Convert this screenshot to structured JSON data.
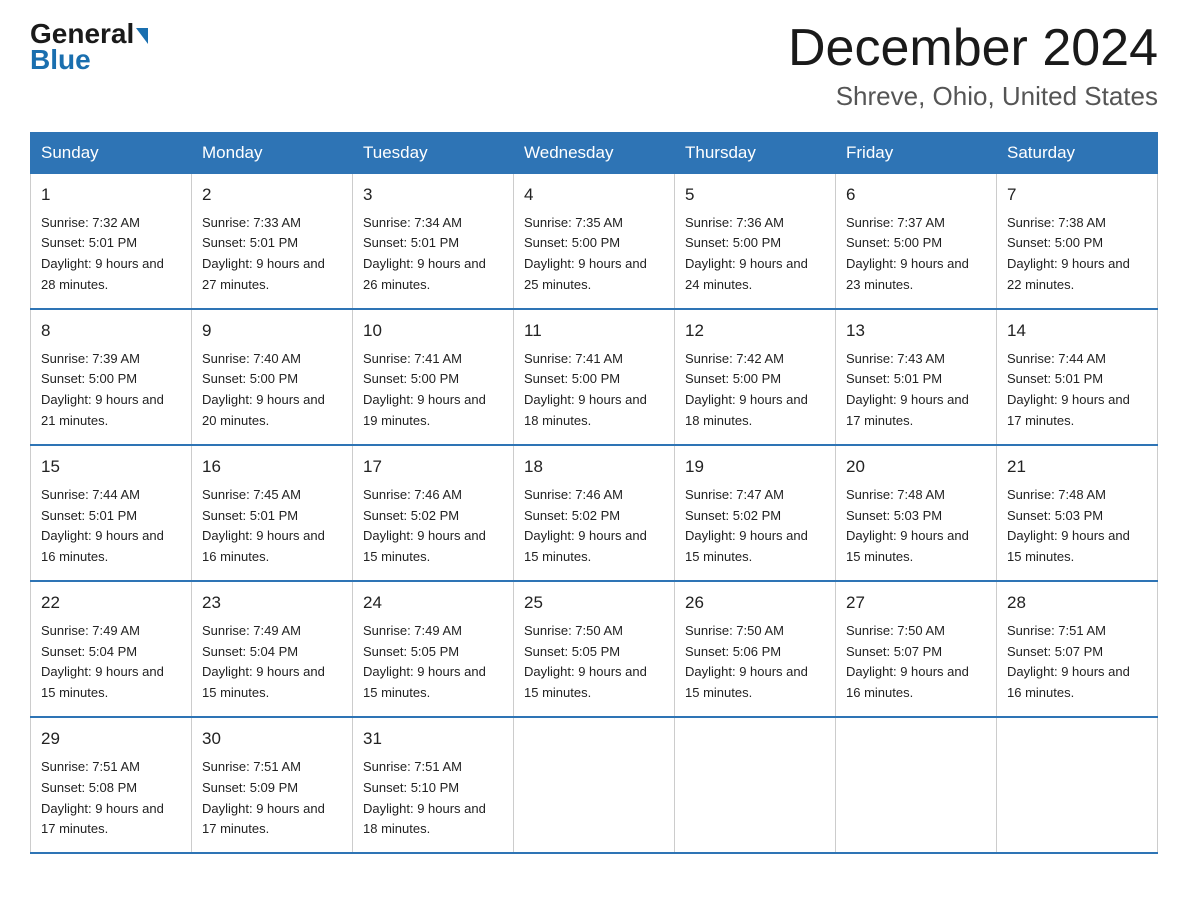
{
  "header": {
    "logo_general": "General",
    "logo_blue": "Blue",
    "month_title": "December 2024",
    "location": "Shreve, Ohio, United States"
  },
  "days_of_week": [
    "Sunday",
    "Monday",
    "Tuesday",
    "Wednesday",
    "Thursday",
    "Friday",
    "Saturday"
  ],
  "weeks": [
    [
      {
        "num": "1",
        "sunrise": "7:32 AM",
        "sunset": "5:01 PM",
        "daylight": "9 hours and 28 minutes."
      },
      {
        "num": "2",
        "sunrise": "7:33 AM",
        "sunset": "5:01 PM",
        "daylight": "9 hours and 27 minutes."
      },
      {
        "num": "3",
        "sunrise": "7:34 AM",
        "sunset": "5:01 PM",
        "daylight": "9 hours and 26 minutes."
      },
      {
        "num": "4",
        "sunrise": "7:35 AM",
        "sunset": "5:00 PM",
        "daylight": "9 hours and 25 minutes."
      },
      {
        "num": "5",
        "sunrise": "7:36 AM",
        "sunset": "5:00 PM",
        "daylight": "9 hours and 24 minutes."
      },
      {
        "num": "6",
        "sunrise": "7:37 AM",
        "sunset": "5:00 PM",
        "daylight": "9 hours and 23 minutes."
      },
      {
        "num": "7",
        "sunrise": "7:38 AM",
        "sunset": "5:00 PM",
        "daylight": "9 hours and 22 minutes."
      }
    ],
    [
      {
        "num": "8",
        "sunrise": "7:39 AM",
        "sunset": "5:00 PM",
        "daylight": "9 hours and 21 minutes."
      },
      {
        "num": "9",
        "sunrise": "7:40 AM",
        "sunset": "5:00 PM",
        "daylight": "9 hours and 20 minutes."
      },
      {
        "num": "10",
        "sunrise": "7:41 AM",
        "sunset": "5:00 PM",
        "daylight": "9 hours and 19 minutes."
      },
      {
        "num": "11",
        "sunrise": "7:41 AM",
        "sunset": "5:00 PM",
        "daylight": "9 hours and 18 minutes."
      },
      {
        "num": "12",
        "sunrise": "7:42 AM",
        "sunset": "5:00 PM",
        "daylight": "9 hours and 18 minutes."
      },
      {
        "num": "13",
        "sunrise": "7:43 AM",
        "sunset": "5:01 PM",
        "daylight": "9 hours and 17 minutes."
      },
      {
        "num": "14",
        "sunrise": "7:44 AM",
        "sunset": "5:01 PM",
        "daylight": "9 hours and 17 minutes."
      }
    ],
    [
      {
        "num": "15",
        "sunrise": "7:44 AM",
        "sunset": "5:01 PM",
        "daylight": "9 hours and 16 minutes."
      },
      {
        "num": "16",
        "sunrise": "7:45 AM",
        "sunset": "5:01 PM",
        "daylight": "9 hours and 16 minutes."
      },
      {
        "num": "17",
        "sunrise": "7:46 AM",
        "sunset": "5:02 PM",
        "daylight": "9 hours and 15 minutes."
      },
      {
        "num": "18",
        "sunrise": "7:46 AM",
        "sunset": "5:02 PM",
        "daylight": "9 hours and 15 minutes."
      },
      {
        "num": "19",
        "sunrise": "7:47 AM",
        "sunset": "5:02 PM",
        "daylight": "9 hours and 15 minutes."
      },
      {
        "num": "20",
        "sunrise": "7:48 AM",
        "sunset": "5:03 PM",
        "daylight": "9 hours and 15 minutes."
      },
      {
        "num": "21",
        "sunrise": "7:48 AM",
        "sunset": "5:03 PM",
        "daylight": "9 hours and 15 minutes."
      }
    ],
    [
      {
        "num": "22",
        "sunrise": "7:49 AM",
        "sunset": "5:04 PM",
        "daylight": "9 hours and 15 minutes."
      },
      {
        "num": "23",
        "sunrise": "7:49 AM",
        "sunset": "5:04 PM",
        "daylight": "9 hours and 15 minutes."
      },
      {
        "num": "24",
        "sunrise": "7:49 AM",
        "sunset": "5:05 PM",
        "daylight": "9 hours and 15 minutes."
      },
      {
        "num": "25",
        "sunrise": "7:50 AM",
        "sunset": "5:05 PM",
        "daylight": "9 hours and 15 minutes."
      },
      {
        "num": "26",
        "sunrise": "7:50 AM",
        "sunset": "5:06 PM",
        "daylight": "9 hours and 15 minutes."
      },
      {
        "num": "27",
        "sunrise": "7:50 AM",
        "sunset": "5:07 PM",
        "daylight": "9 hours and 16 minutes."
      },
      {
        "num": "28",
        "sunrise": "7:51 AM",
        "sunset": "5:07 PM",
        "daylight": "9 hours and 16 minutes."
      }
    ],
    [
      {
        "num": "29",
        "sunrise": "7:51 AM",
        "sunset": "5:08 PM",
        "daylight": "9 hours and 17 minutes."
      },
      {
        "num": "30",
        "sunrise": "7:51 AM",
        "sunset": "5:09 PM",
        "daylight": "9 hours and 17 minutes."
      },
      {
        "num": "31",
        "sunrise": "7:51 AM",
        "sunset": "5:10 PM",
        "daylight": "9 hours and 18 minutes."
      },
      null,
      null,
      null,
      null
    ]
  ]
}
